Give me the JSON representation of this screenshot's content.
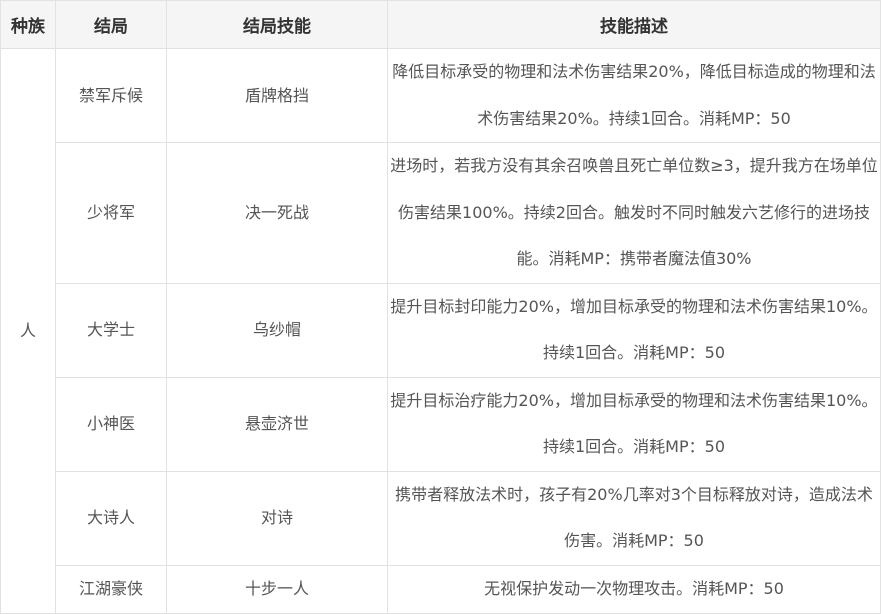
{
  "table": {
    "headers": [
      "种族",
      "结局",
      "结局技能",
      "技能描述"
    ],
    "race": "人",
    "rows": [
      {
        "ending": "禁军斥候",
        "skill": "盾牌格挡",
        "description": "降低目标承受的物理和法术伤害结果20%，降低目标造成的物理和法术伤害结果20%。持续1回合。消耗MP：50"
      },
      {
        "ending": "少将军",
        "skill": "决一死战",
        "description": "进场时，若我方没有其余召唤兽且死亡单位数≥3，提升我方在场单位伤害结果100%。持续2回合。触发时不同时触发六艺修行的进场技能。消耗MP：携带者魔法值30%"
      },
      {
        "ending": "大学士",
        "skill": "乌纱帽",
        "description": "提升目标封印能力20%，增加目标承受的物理和法术伤害结果10%。持续1回合。消耗MP：50"
      },
      {
        "ending": "小神医",
        "skill": "悬壶济世",
        "description": "提升目标治疗能力20%，增加目标承受的物理和法术伤害结果10%。持续1回合。消耗MP：50"
      },
      {
        "ending": "大诗人",
        "skill": "对诗",
        "description": "携带者释放法术时，孩子有20%几率对3个目标释放对诗，造成法术伤害。消耗MP：50"
      },
      {
        "ending": "江湖豪侠",
        "skill": "十步一人",
        "description": "无视保护发动一次物理攻击。消耗MP：50"
      }
    ]
  }
}
